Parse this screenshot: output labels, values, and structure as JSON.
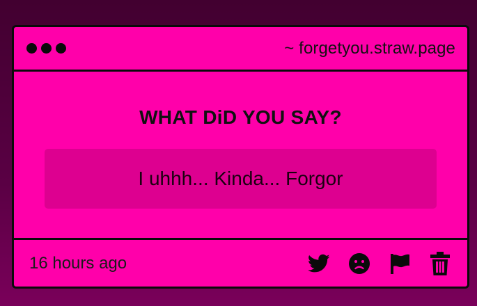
{
  "window": {
    "url": "~ forgetyou.straw.page"
  },
  "card": {
    "question": "WHAT DiD YOU SAY?",
    "answer": "I uhhh... Kinda... Forgor",
    "timestamp": "16 hours ago"
  },
  "actions": [
    {
      "name": "twitter-icon"
    },
    {
      "name": "sad-face-icon"
    },
    {
      "name": "flag-icon"
    },
    {
      "name": "trash-icon"
    }
  ],
  "colors": {
    "background": "#4a0036",
    "card": "#ff00aa",
    "answer_box": "#dd0090",
    "border": "#0a0a0a"
  }
}
